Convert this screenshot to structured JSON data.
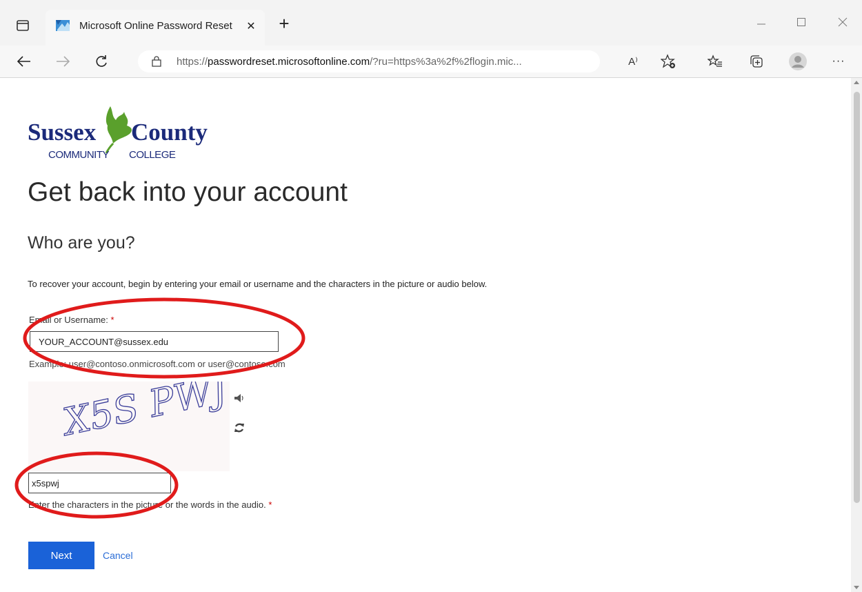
{
  "browser": {
    "tab_title": "Microsoft Online Password Reset",
    "url_scheme": "https://",
    "url_host": "passwordreset.microsoftonline.com",
    "url_rest": "/?ru=https%3a%2f%2flogin.mic...",
    "read_aloud_label": "A⁾",
    "icons": [
      "tab-actions-icon",
      "microsoft-favicon",
      "tab-close-icon",
      "new-tab-icon",
      "back-icon",
      "forward-icon",
      "refresh-icon",
      "site-info-icon",
      "read-aloud-icon",
      "add-favorite-icon",
      "favorites-icon",
      "collections-icon",
      "profile-icon",
      "more-icon",
      "minimize-icon",
      "maximize-icon",
      "window-close-icon"
    ]
  },
  "logo": {
    "line1_left": "Sussex",
    "line1_right": "County",
    "line2_left": "COMMUNITY",
    "line2_right": "COLLEGE",
    "colors": {
      "navy": "#1b2a7a",
      "leaf": "#5aa02c"
    }
  },
  "page": {
    "title": "Get back into your account",
    "subtitle": "Who are you?",
    "instructions": "To recover your account, begin by entering your email or username and the characters in the picture or audio below.",
    "email_label": "Email or Username:",
    "required_mark": "*",
    "email_value": "YOUR_ACCOUNT@sussex.edu",
    "example_text": "Example: user@contoso.onmicrosoft.com or user@contoso.com",
    "captcha_value": "x5spwj",
    "captcha_image_text": "X5S PWJ",
    "captcha_note": "Enter the characters in the picture or the words in the audio.",
    "next_label": "Next",
    "cancel_label": "Cancel"
  },
  "colors": {
    "primary_button": "#1a62d8",
    "annotation": "#e01b1b",
    "required": "#cc0000"
  }
}
